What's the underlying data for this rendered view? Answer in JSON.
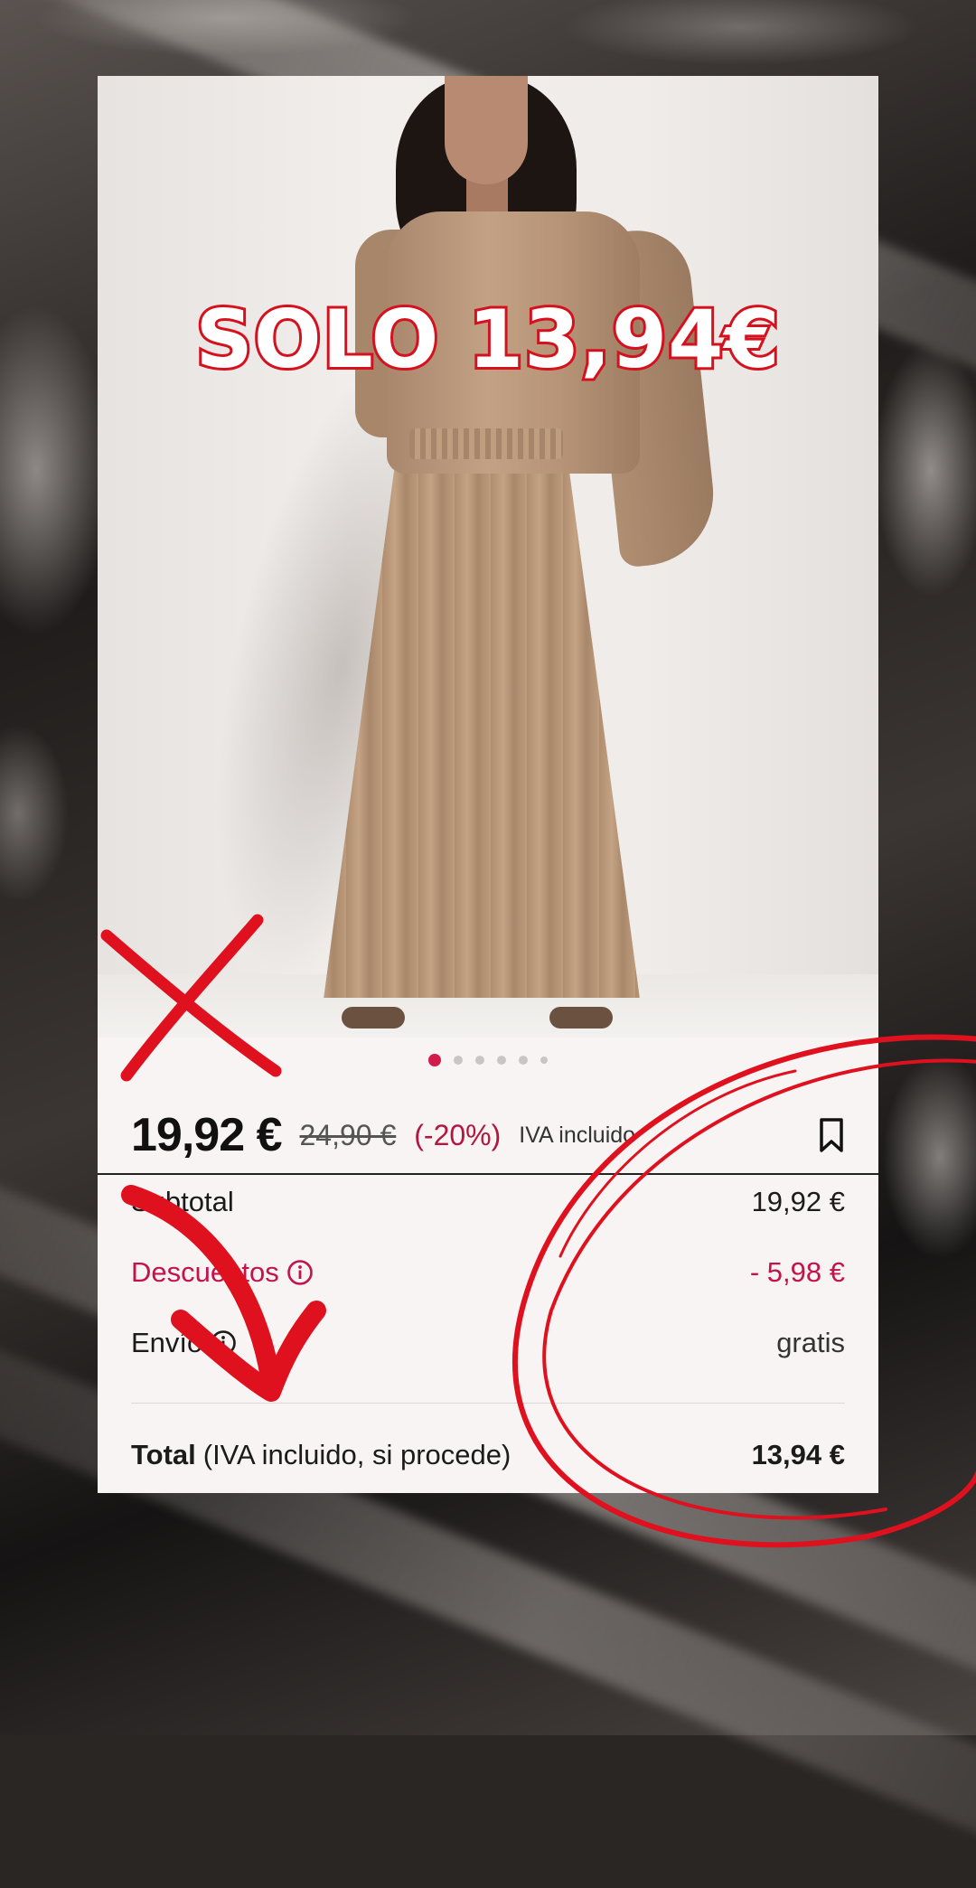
{
  "headline": {
    "text": "SOLO 13,94€"
  },
  "gallery": {
    "total_images": 6,
    "active_index": 0
  },
  "product": {
    "price": "19,92 €",
    "old_price": "24,90 €",
    "discount": "(-20%)",
    "vat_note": "IVA incluido"
  },
  "summary": {
    "subtotal_label": "Subtotal",
    "subtotal_value": "19,92 €",
    "discounts_label": "Descuentos",
    "discounts_value": "- 5,98 €",
    "shipping_label": "Envío",
    "shipping_value": "gratis",
    "total_label": "Total",
    "total_note": "(IVA incluido, si procede)",
    "total_value": "13,94 €"
  },
  "icons": {
    "bookmark": "bookmark-icon",
    "info": "info-icon"
  },
  "colors": {
    "accent": "#d31b4b",
    "annotation": "#e0111f",
    "discount": "#c4124a"
  }
}
